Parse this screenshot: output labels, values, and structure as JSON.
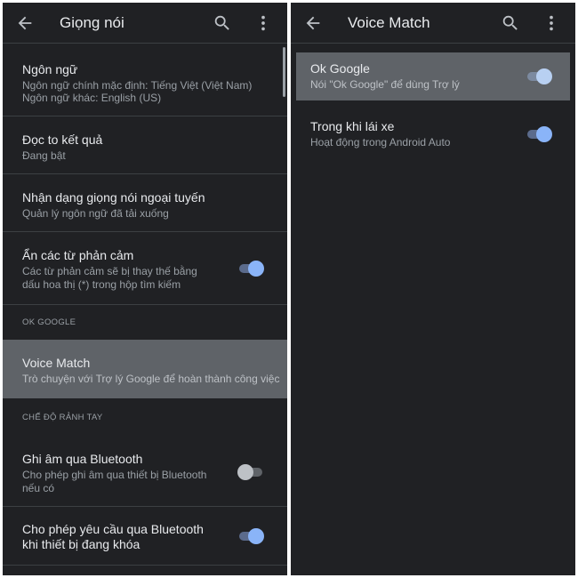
{
  "left": {
    "title": "Giọng nói",
    "items": [
      {
        "title": "Ngôn ngữ",
        "subtitle_1": "Ngôn ngữ chính mặc định: Tiếng Việt (Việt Nam)",
        "subtitle_2": "Ngôn ngữ khác: English (US)"
      },
      {
        "title": "Đọc to kết quả",
        "subtitle_1": "Đang bật"
      },
      {
        "title": "Nhận dạng giọng nói ngoại tuyến",
        "subtitle_1": "Quản lý ngôn ngữ đã tải xuống"
      },
      {
        "title": "Ẩn các từ phản cảm",
        "subtitle_1": "Các từ phản cảm sẽ bị thay thế bằng",
        "subtitle_2": "dấu hoa thị (*) trong hộp tìm kiếm",
        "toggle": true
      },
      {
        "title": "Voice Match",
        "subtitle_1": "Trò chuyện với Trợ lý Google để hoàn thành công việc"
      },
      {
        "title": "Ghi âm qua Bluetooth",
        "subtitle_1": "Cho phép ghi âm qua thiết bị Bluetooth",
        "subtitle_2": "nếu có",
        "toggle": false
      },
      {
        "title_1": "Cho phép yêu cầu qua Bluetooth",
        "title_2": "khi thiết bị đang khóa",
        "toggle": true
      }
    ],
    "sections": {
      "ok_google": "OK GOOGLE",
      "hands_free": "CHẾ ĐỘ RẢNH TAY"
    }
  },
  "right": {
    "title": "Voice Match",
    "items": [
      {
        "title": "Ok Google",
        "subtitle_1": "Nói \"Ok Google\" để dùng Trợ lý",
        "toggle": true
      },
      {
        "title": "Trong khi lái xe",
        "subtitle_1": "Hoạt động trong Android Auto",
        "toggle": true
      }
    ]
  },
  "icons": [
    "back-arrow-icon",
    "search-icon",
    "more-vert-icon"
  ],
  "colors": {
    "background": "#202124",
    "highlight": "#5f6368",
    "accent": "#8ab4f8"
  }
}
